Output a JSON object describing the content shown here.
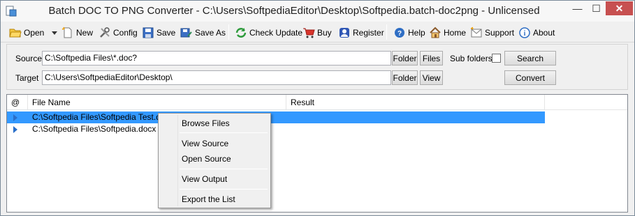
{
  "window": {
    "title": "Batch DOC TO PNG Converter - C:\\Users\\SoftpediaEditor\\Desktop\\Softpedia.batch-doc2png - Unlicensed",
    "minimize": "—",
    "maximize": "☐",
    "close": "✕"
  },
  "toolbar": {
    "open": "Open",
    "new": "New",
    "config": "Config",
    "save": "Save",
    "save_as": "Save As",
    "check_update": "Check Update",
    "buy": "Buy",
    "register": "Register",
    "help": "Help",
    "home": "Home",
    "support": "Support",
    "about": "About"
  },
  "io": {
    "source_label": "Source",
    "source_value": "C:\\Softpedia Files\\*.doc?",
    "target_label": "Target",
    "target_value": "C:\\Users\\SoftpediaEditor\\Desktop\\",
    "folder_button": "Folder",
    "files_button": "Files",
    "view_button": "View",
    "subfolders_label": "Sub folders",
    "subfolders_checked": false,
    "search_button": "Search",
    "convert_button": "Convert"
  },
  "list": {
    "columns": [
      "@",
      "File Name",
      "Result"
    ],
    "rows": [
      {
        "file": "C:\\Softpedia Files\\Softpedia Test.docx",
        "result": "",
        "selected": true
      },
      {
        "file": "C:\\Softpedia Files\\Softpedia.docx",
        "result": "",
        "selected": false
      }
    ]
  },
  "context_menu": {
    "items": [
      "Browse Files",
      "View  Source",
      "Open Source",
      "View  Output",
      "Export the List"
    ]
  }
}
